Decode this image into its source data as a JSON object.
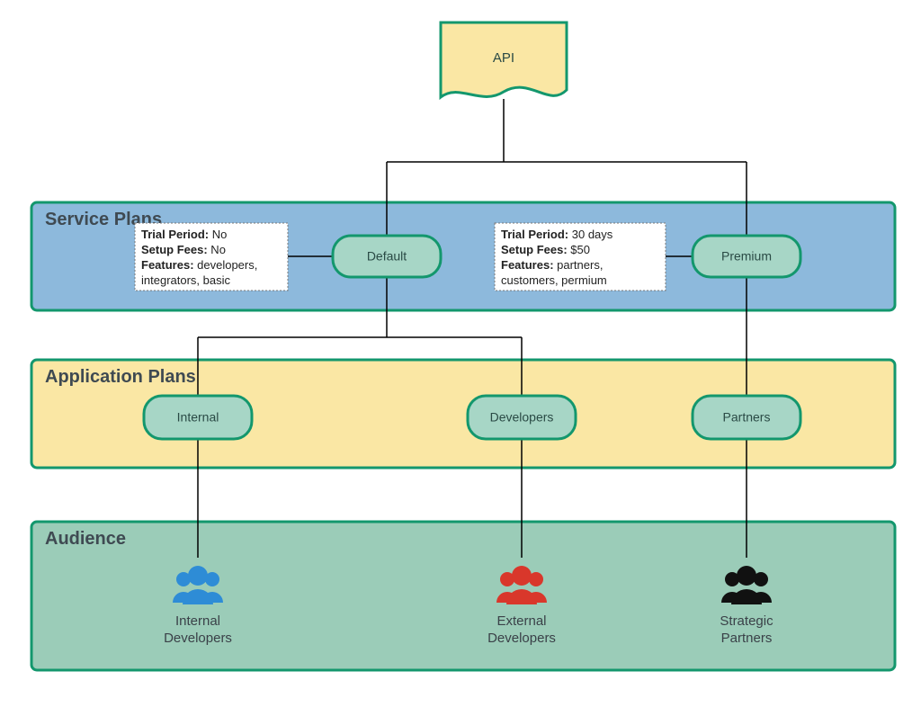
{
  "api_label": "API",
  "tiers": {
    "service_plans": "Service Plans",
    "application_plans": "Application Plans",
    "audience": "Audience"
  },
  "service_plan_nodes": {
    "default": "Default",
    "premium": "Premium"
  },
  "service_plan_details": {
    "default": {
      "trial_label": "Trial Period:",
      "trial_value": " No",
      "fees_label": "Setup Fees:",
      "fees_value": " No",
      "features_label": "Features:",
      "features_value": " developers, integrators, basic"
    },
    "premium": {
      "trial_label": "Trial Period:",
      "trial_value": " 30 days",
      "fees_label": "Setup Fees:",
      "fees_value": " $50",
      "features_label": "Features:",
      "features_value": " partners, customers, permium"
    }
  },
  "application_plan_nodes": {
    "internal": "Internal",
    "developers": "Developers",
    "partners": "Partners"
  },
  "audiences": {
    "internal_dev_l1": "Internal",
    "internal_dev_l2": "Developers",
    "external_dev_l1": "External",
    "external_dev_l2": "Developers",
    "strategic_l1": "Strategic",
    "strategic_l2": "Partners"
  },
  "colors": {
    "teal_stroke": "#13976d",
    "teal_fill_light": "#a8d9c8",
    "teal_node": "#a7d6c6",
    "blue_tier": "#8db9dc",
    "yellow_tier": "#fae7a4",
    "green_tier": "#9bccb8",
    "api_fill": "#fae7a4",
    "icon_blue": "#2e8cd6",
    "icon_red": "#d9372b",
    "icon_black": "#111111"
  }
}
